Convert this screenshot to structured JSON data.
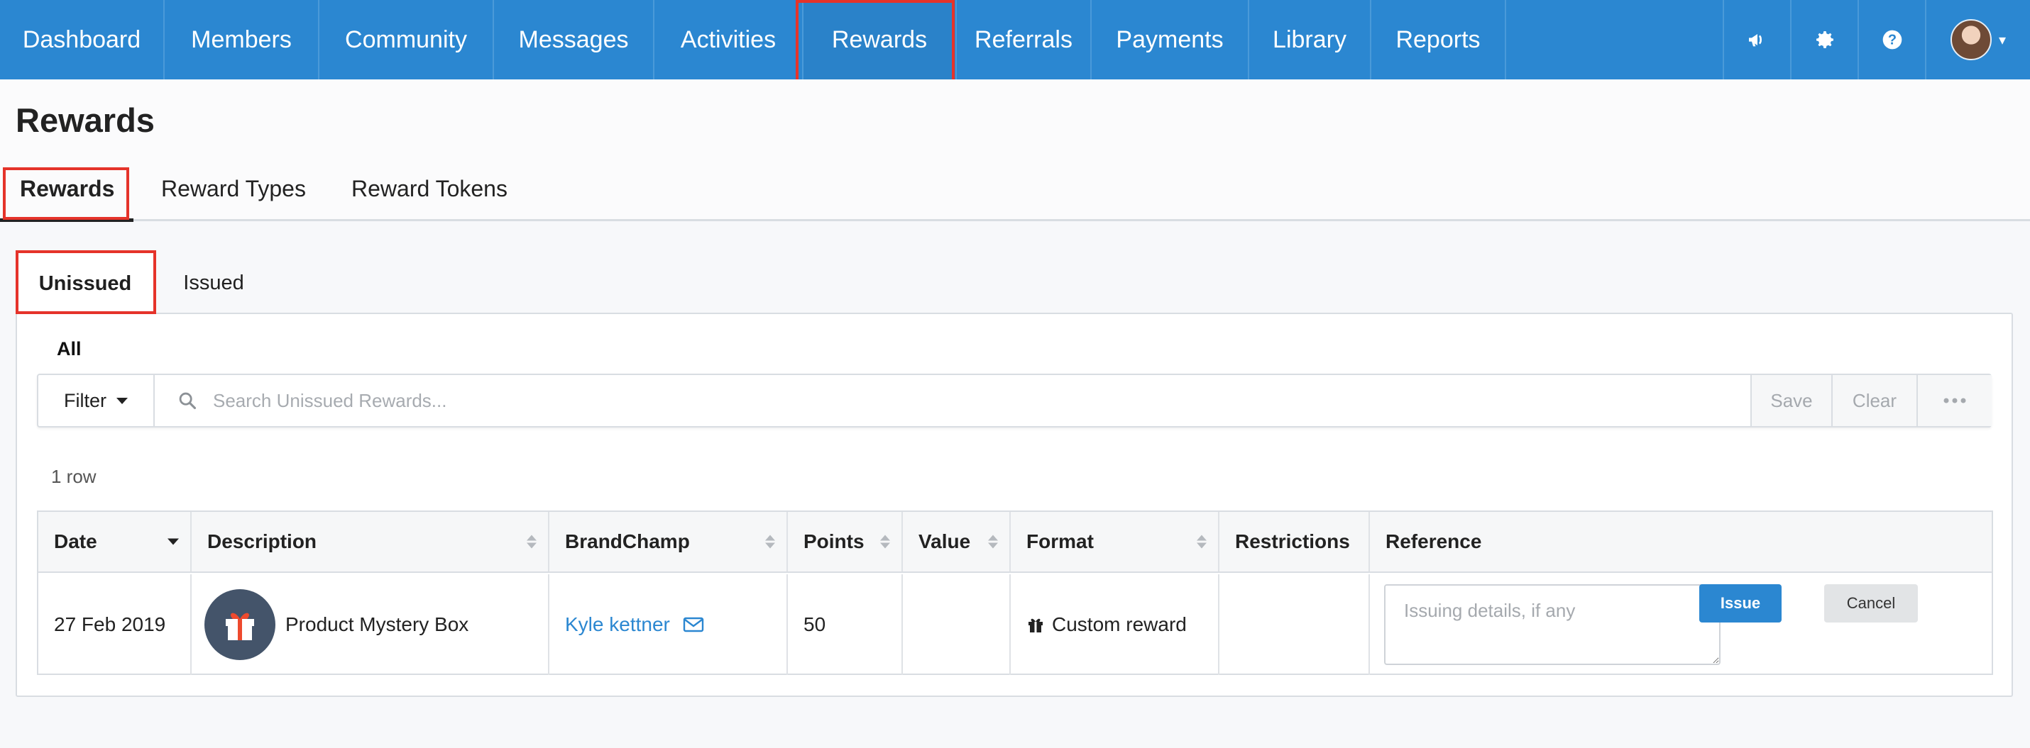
{
  "nav": {
    "items": [
      {
        "label": "Dashboard"
      },
      {
        "label": "Members"
      },
      {
        "label": "Community"
      },
      {
        "label": "Messages"
      },
      {
        "label": "Activities"
      },
      {
        "label": "Rewards"
      },
      {
        "label": "Referrals"
      },
      {
        "label": "Payments"
      },
      {
        "label": "Library"
      },
      {
        "label": "Reports"
      }
    ],
    "active": "Rewards",
    "right_icons": [
      "megaphone-icon",
      "gear-icon",
      "help-icon",
      "avatar"
    ]
  },
  "page": {
    "title": "Rewards",
    "tabs": [
      {
        "label": "Rewards"
      },
      {
        "label": "Reward Types"
      },
      {
        "label": "Reward Tokens"
      }
    ],
    "active_tab": "Rewards"
  },
  "subtabs": {
    "items": [
      {
        "label": "Unissued"
      },
      {
        "label": "Issued"
      }
    ],
    "active": "Unissued"
  },
  "view": {
    "all_label": "All"
  },
  "filterbar": {
    "filter_label": "Filter",
    "search_placeholder": "Search Unissued Rewards...",
    "save_label": "Save",
    "clear_label": "Clear",
    "more_icon": "more-icon"
  },
  "table": {
    "row_count": "1 row",
    "columns": [
      "Date",
      "Description",
      "BrandChamp",
      "Points",
      "Value",
      "Format",
      "Restrictions",
      "Reference"
    ],
    "sort_column": "Date",
    "rows": [
      {
        "date": "27 Feb 2019",
        "description": "Product Mystery Box",
        "brandchamp": "Kyle kettner",
        "points": "50",
        "value": "",
        "format": "Custom reward",
        "restrictions": "",
        "reference_placeholder": "Issuing details, if any",
        "issue_label": "Issue",
        "cancel_label": "Cancel"
      }
    ]
  },
  "colors": {
    "nav_bg": "#2b87d1",
    "highlight": "#e5332a",
    "link": "#2b87d1",
    "issue_button": "#2b87d1"
  }
}
